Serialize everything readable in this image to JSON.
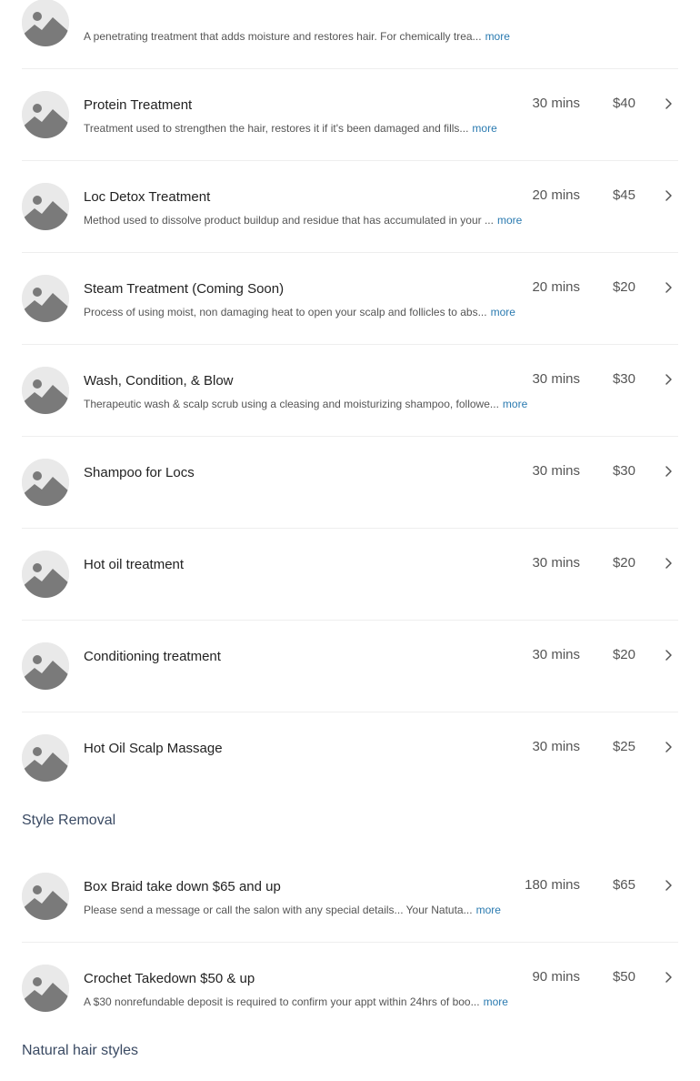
{
  "groups": [
    {
      "items": [
        {
          "name": "",
          "desc": "A penetrating treatment that adds moisture and restores hair. For chemically trea...",
          "more": "more",
          "duration": "",
          "price": ""
        },
        {
          "name": "Protein Treatment",
          "desc": "Treatment used to strengthen the hair, restores it if it's been damaged and fills...",
          "more": "more",
          "duration": "30 mins",
          "price": "$40"
        },
        {
          "name": "Loc Detox Treatment",
          "desc": "Method used to dissolve product buildup and residue that has accumulated in your ...",
          "more": "more",
          "duration": "20 mins",
          "price": "$45"
        },
        {
          "name": "Steam Treatment (Coming Soon)",
          "desc": "Process of using moist, non damaging heat to open your scalp and follicles to abs...",
          "more": "more",
          "duration": "20 mins",
          "price": "$20"
        },
        {
          "name": "Wash, Condition, & Blow",
          "desc": "Therapeutic wash & scalp scrub using a cleasing and moisturizing shampoo, followe...",
          "more": "more",
          "duration": "30 mins",
          "price": "$30"
        },
        {
          "name": "Shampoo for Locs",
          "desc": "",
          "more": "",
          "duration": "30 mins",
          "price": "$30"
        },
        {
          "name": "Hot oil treatment",
          "desc": "",
          "more": "",
          "duration": "30 mins",
          "price": "$20"
        },
        {
          "name": "Conditioning treatment",
          "desc": "",
          "more": "",
          "duration": "30 mins",
          "price": "$20"
        },
        {
          "name": "Hot Oil Scalp Massage",
          "desc": "",
          "more": "",
          "duration": "30 mins",
          "price": "$25"
        }
      ]
    },
    {
      "title": "Style Removal",
      "items": [
        {
          "name": "Box Braid take down $65 and up",
          "desc": "Please send a message  or call the salon with  any special details... Your Natuta...",
          "more": "more",
          "duration": "180 mins",
          "price": "$65"
        },
        {
          "name": "Crochet Takedown $50 & up",
          "desc": "A $30 nonrefundable deposit is required to confirm your appt  within 24hrs of boo...",
          "more": "more",
          "duration": "90 mins",
          "price": "$50"
        }
      ]
    },
    {
      "title": "Natural hair styles",
      "items": []
    }
  ],
  "icons": {
    "thumbnail": "image-placeholder-icon",
    "chevron": "chevron-right-icon"
  },
  "colors": {
    "link": "#2a7ab0",
    "section_title": "#3a4a63",
    "divider": "#eeeeee"
  }
}
